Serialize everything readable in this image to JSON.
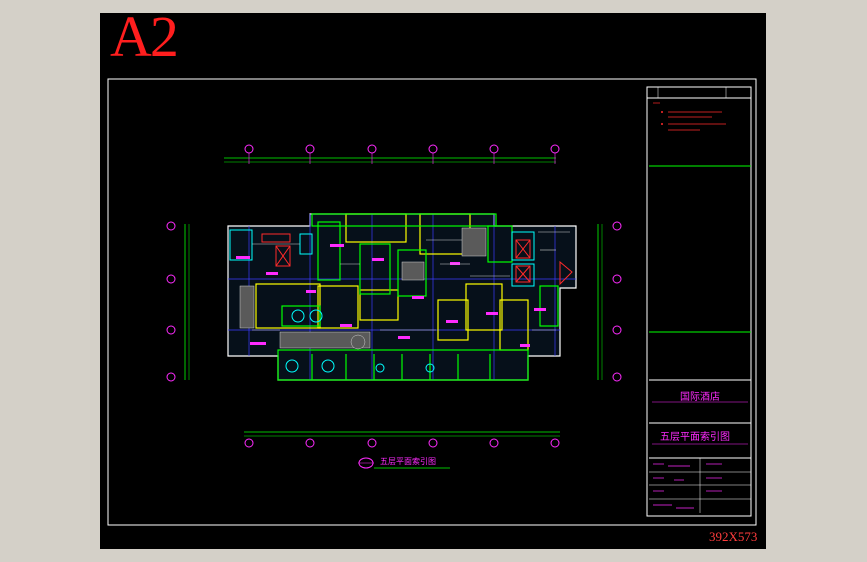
{
  "sheet": {
    "size_label": "A2",
    "scale_label": "392X573"
  },
  "title_block": {
    "hotel_name": "国际酒店",
    "drawing_title": "五层平面索引图"
  },
  "plan": {
    "caption": "五层平面索引图"
  },
  "colors": {
    "sheet_background": "#000000",
    "frame_border": "#ffffff",
    "label_red": "#ff1e1e",
    "text_magenta": "#ff2bff",
    "line_green": "#00ff00",
    "line_yellow": "#ffff00",
    "line_cyan": "#00ffff",
    "line_blue": "#3c3cff"
  }
}
